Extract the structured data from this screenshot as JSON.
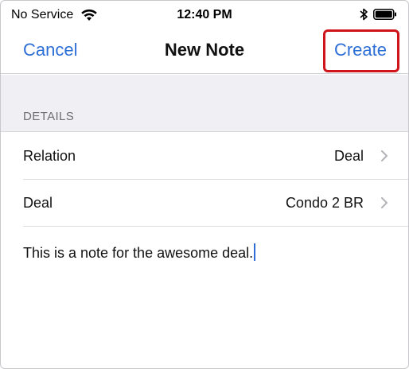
{
  "status_bar": {
    "carrier": "No Service",
    "time": "12:40 PM"
  },
  "nav": {
    "cancel_label": "Cancel",
    "title": "New Note",
    "create_label": "Create",
    "highlight_color": "#d0141b",
    "accent_color": "#2d6fd6"
  },
  "section": {
    "header": "DETAILS"
  },
  "rows": [
    {
      "label": "Relation",
      "value": "Deal"
    },
    {
      "label": "Deal",
      "value": "Condo 2 BR"
    }
  ],
  "note": {
    "text": "This is a note for the awesome deal."
  }
}
